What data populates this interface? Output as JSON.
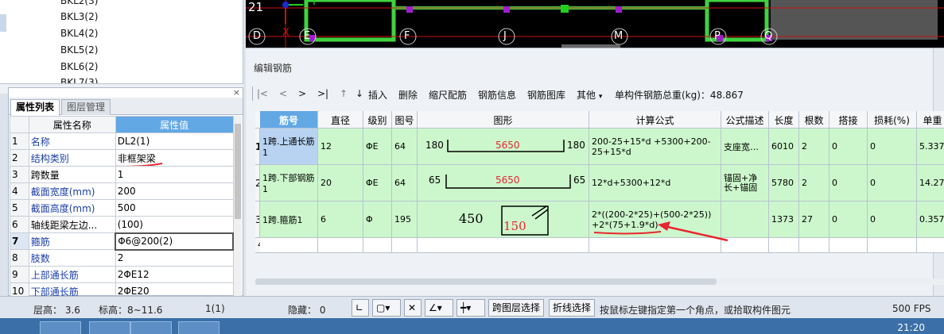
{
  "tree": {
    "items": [
      "BKL2(3)",
      "BKL3(2)",
      "BKL4(2)",
      "BKL5(2)",
      "BKL6(2)",
      "BKL7(3)"
    ]
  },
  "prop_panel": {
    "close": "×",
    "tabs": [
      "属性列表",
      "图层管理"
    ],
    "headers": {
      "name": "属性名称",
      "value": "属性值"
    },
    "rows": [
      {
        "n": "1",
        "name": "名称",
        "value": "DL2(1)",
        "blue": true
      },
      {
        "n": "2",
        "name": "结构类别",
        "value": "非框架梁",
        "blue": true
      },
      {
        "n": "3",
        "name": "跨数量",
        "value": "1",
        "blue": false
      },
      {
        "n": "4",
        "name": "截面宽度(mm)",
        "value": "200",
        "blue": true
      },
      {
        "n": "5",
        "name": "截面高度(mm)",
        "value": "500",
        "blue": true
      },
      {
        "n": "6",
        "name": "轴线距梁左边...",
        "value": "(100)",
        "blue": false
      },
      {
        "n": "7",
        "name": "箍筋",
        "value": "Φ6@200(2)",
        "blue": true,
        "selected": true
      },
      {
        "n": "8",
        "name": "肢数",
        "value": "2",
        "blue": true
      },
      {
        "n": "9",
        "name": "上部通长筋",
        "value": "2ΦE12",
        "blue": true
      },
      {
        "n": "10",
        "name": "下部通长筋",
        "value": "2ΦE20",
        "blue": true
      }
    ]
  },
  "cad": {
    "labels_top": [
      "21",
      "Y"
    ],
    "labels_axis": [
      "D",
      "X",
      "E",
      "F",
      "J",
      "M",
      "P",
      "Q"
    ]
  },
  "editor": {
    "title": "编辑钢筋",
    "toolbar": {
      "first": "|<",
      "prev": "<",
      "next": ">",
      "last": ">|",
      "up": "↑",
      "down": "↓",
      "insert": "插入",
      "delete": "删除",
      "scale_rebar": "缩尺配筋",
      "rebar_info": "钢筋信息",
      "rebar_lib": "钢筋图库",
      "other": "其他",
      "total_weight": "单构件钢筋总重(kg)：48.867"
    },
    "columns": [
      "筋号",
      "直径(mm)",
      "级别",
      "图号",
      "图形",
      "计算公式",
      "公式描述",
      "长度",
      "根数",
      "搭接",
      "损耗(%)",
      "单重"
    ],
    "rows": [
      {
        "rn": "1",
        "code": "1跨.上通长筋1",
        "dia": "12",
        "grade": "ΦE",
        "fig": "64",
        "shape": {
          "left": "180",
          "mid": "5650",
          "right": "180"
        },
        "formula": "200-25+15*d +5300+200-25+15*d",
        "desc": "支座宽…",
        "length": "6010",
        "count": "2",
        "lap": "0",
        "loss": "0",
        "unit_weight": "5.337"
      },
      {
        "rn": "2",
        "code": "1跨.下部钢筋1",
        "dia": "20",
        "grade": "ΦE",
        "fig": "64",
        "shape": {
          "left": "65",
          "mid": "5650",
          "right": "65"
        },
        "formula": "12*d+5300+12*d",
        "desc": "锚固+净长+锚固",
        "length": "5780",
        "count": "2",
        "lap": "0",
        "loss": "0",
        "unit_weight": "14.27"
      },
      {
        "rn": "3",
        "code": "1跨.箍筋1",
        "dia": "6",
        "grade": "Φ",
        "fig": "195",
        "shape": {
          "left": "450",
          "mid": "150"
        },
        "formula": "2*((200-2*25)+(500-2*25)) +2*(75+1.9*d)",
        "desc": "",
        "length": "1373",
        "count": "27",
        "lap": "0",
        "loss": "0",
        "unit_weight": "0.357"
      },
      {
        "rn": "4"
      }
    ]
  },
  "status": {
    "floor_height": "层高：  3.6",
    "elevation": "标高：8~11.6",
    "count": "1(1)",
    "hidden": "隐藏：  0",
    "cross_layer": "跨图层选择",
    "polyline_select": "折线选择",
    "hint": "按鼠标左键指定第一个角点，或拾取构件图元",
    "fps": "500 FPS"
  },
  "taskbar": {
    "clock": "21:20"
  },
  "colors": {
    "annotation_red": "#e8262f",
    "header_blue": "#62a8e5",
    "row_green": "#ccf7cc"
  }
}
